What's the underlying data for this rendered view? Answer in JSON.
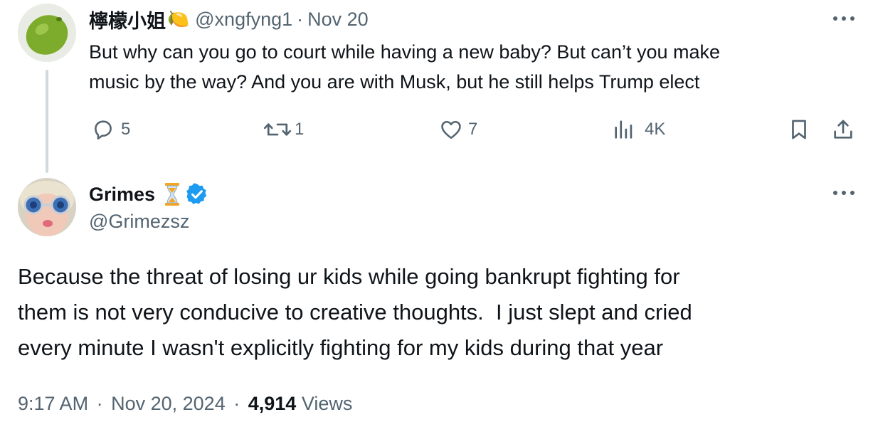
{
  "reply_to": {
    "display_name": "檸檬小姐",
    "name_emoji": "🍋",
    "handle": "@xngfyng1",
    "separator": "·",
    "date": "Nov 20",
    "text_lines": [
      "But why can you go to court while having a new baby? But can’t you make",
      "music by the way? And you are with Musk, but he still helps Trump elect"
    ],
    "actions": {
      "replies": "5",
      "reposts": "1",
      "likes": "7",
      "views": "4K"
    },
    "icons": [
      "reply-icon",
      "repost-icon",
      "like-icon",
      "views-icon",
      "bookmark-icon",
      "share-icon",
      "more-icon"
    ]
  },
  "main_tweet": {
    "display_name": "Grimes",
    "name_emoji": "⏳",
    "verified": true,
    "handle": "@Grimezsz",
    "text_lines": [
      "Because the threat of losing ur kids while going bankrupt fighting for",
      "them is not very conducive to creative thoughts.  I just slept and cried",
      "every minute I wasn't explicitly fighting for my kids during that year"
    ],
    "time": "9:17 AM",
    "separator": "·",
    "date": "Nov 20, 2024",
    "views_count": "4,914",
    "views_label": "Views"
  },
  "colors": {
    "text": "#0f1419",
    "muted": "#536471",
    "verified_blue": "#1d9bf0",
    "thread_line": "#cfd9de"
  }
}
